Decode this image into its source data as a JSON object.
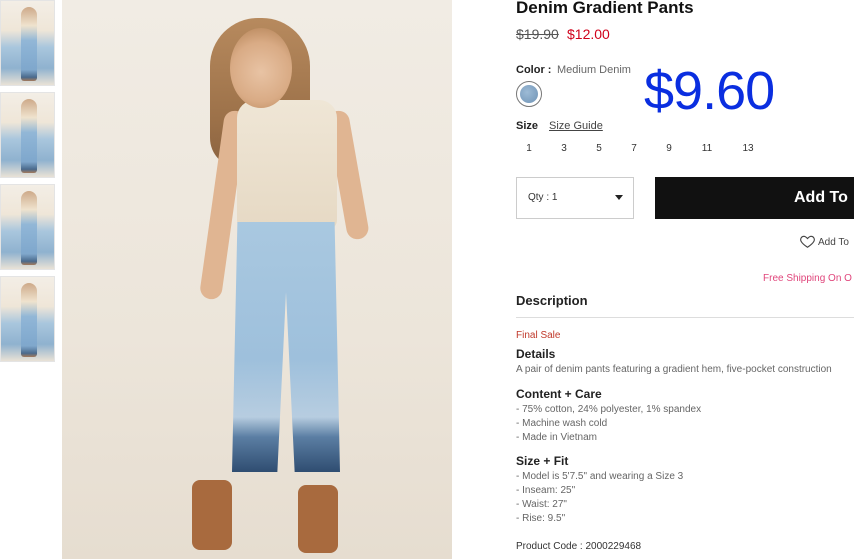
{
  "thumbnails": [
    "thumb-1",
    "thumb-2",
    "thumb-3",
    "thumb-4"
  ],
  "product": {
    "title": "Denim Gradient Pants",
    "price_original": "$19.90",
    "price_sale": "$12.00",
    "overlay_price": "$9.60",
    "color_label": "Color :",
    "color_value": "Medium Denim",
    "swatch_color": "#7fa2c4",
    "size_label": "Size",
    "size_guide": "Size Guide",
    "sizes": [
      "1",
      "3",
      "5",
      "7",
      "9",
      "11",
      "13"
    ],
    "qty": "Qty : 1",
    "add_button": "Add To",
    "wishlist": "Add To",
    "free_shipping": "Free Shipping On O"
  },
  "description": {
    "header": "Description",
    "final_sale": "Final Sale",
    "details_title": "Details",
    "details_text": "A pair of denim pants featuring a gradient hem, five-pocket construction",
    "content_title": "Content + Care",
    "content_lines": [
      "- 75% cotton, 24% polyester, 1% spandex",
      "- Machine wash cold",
      "- Made in Vietnam"
    ],
    "fit_title": "Size + Fit",
    "fit_lines": [
      "- Model is 5'7.5\" and wearing a Size 3",
      "- Inseam: 25\"",
      "- Waist: 27\"",
      "- Rise: 9.5\""
    ],
    "product_code": "Product Code : 2000229468"
  },
  "colors": {
    "accent_price": "#d0021b",
    "overlay_price": "#0a2ee0",
    "free_shipping": "#e0457b",
    "button_bg": "#111111"
  }
}
